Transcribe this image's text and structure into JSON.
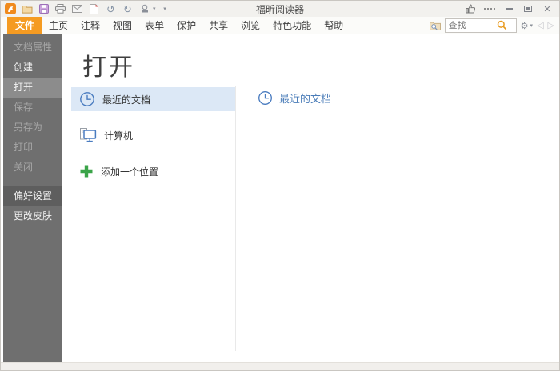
{
  "window": {
    "title": "福昕阅读器"
  },
  "icons": {
    "gear": "⚙",
    "caret_down": "▾",
    "undo": "↺",
    "redo": "↻",
    "back": "◁",
    "forward": "▷",
    "close": "✕"
  },
  "menubar": {
    "tabs": [
      "文件",
      "主页",
      "注释",
      "视图",
      "表单",
      "保护",
      "共享",
      "浏览",
      "特色功能",
      "帮助"
    ],
    "active_tab": "文件",
    "search_placeholder": "查找"
  },
  "sidebar": {
    "items": [
      "文档属性",
      "创建",
      "打开",
      "保存",
      "另存为",
      "打印",
      "关闭",
      "偏好设置",
      "更改皮肤"
    ],
    "selected": "打开",
    "disabled_items": [
      "文档属性",
      "保存",
      "另存为",
      "打印",
      "关闭"
    ]
  },
  "main": {
    "heading": "打开",
    "places": [
      "最近的文档",
      "计算机",
      "添加一个位置"
    ],
    "selected_place": "最近的文档",
    "recent_header": "最近的文档"
  },
  "colors": {
    "accent_orange": "#F59B22",
    "link_blue": "#4A7CB8",
    "plus_green": "#3BA449",
    "sidebar_gray": "#6F6F6F",
    "selected_row_blue": "#DCE8F6"
  }
}
